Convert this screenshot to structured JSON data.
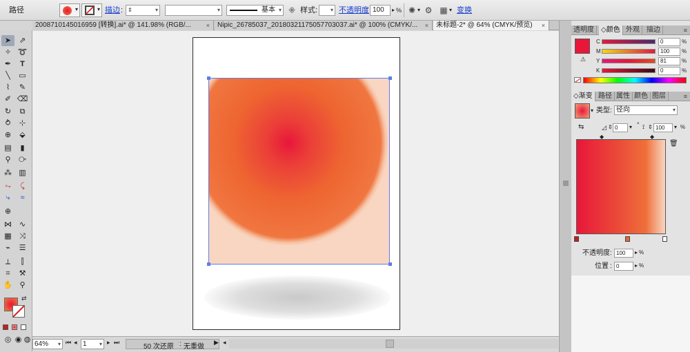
{
  "control_bar": {
    "object_type": "路径",
    "stroke_label": "描边",
    "stroke_profile_label": "基本",
    "style_label": "样式",
    "opacity_label": "不透明度",
    "opacity_value": "100",
    "opacity_unit": "%",
    "transform_label": "变换"
  },
  "tabs": [
    {
      "label": "2008710145016959 [转换].ai* @ 141.98% (RGB/...",
      "close": "×"
    },
    {
      "label": "Nipic_26785037_20180321175057703037.ai* @ 100% (CMYK/...",
      "close": "×"
    },
    {
      "label": "未标题-2* @ 64% (CMYK/预览)",
      "close": "×"
    }
  ],
  "status_bar": {
    "zoom": "64%",
    "artboard_number": "1",
    "undo_text": "50 次还原",
    "redo_text": "无重做"
  },
  "color_panel": {
    "tabs": [
      "透明度",
      "颜色",
      "外观",
      "描边"
    ],
    "active_tab": "颜色",
    "channels": [
      {
        "name": "C",
        "value": "0"
      },
      {
        "name": "M",
        "value": "100"
      },
      {
        "name": "Y",
        "value": "81"
      },
      {
        "name": "K",
        "value": "0"
      }
    ],
    "unit": "%"
  },
  "gradient_panel": {
    "tabs": [
      "渐变",
      "路径",
      "属性",
      "颜色",
      "图层"
    ],
    "active_tab": "渐变",
    "type_label": "类型",
    "type_value": "径向",
    "angle_value": "0",
    "angle_unit": "°",
    "aspect_value": "100",
    "aspect_unit": "%",
    "opacity_label": "不透明度",
    "opacity_value": "100",
    "position_label": "位置",
    "position_value": "0",
    "unit": "%"
  },
  "colors": {
    "fill": "#e8173a",
    "gradient_start": "#e8173a",
    "gradient_mid": "#ef6f3a",
    "gradient_end": "#f8d6c2",
    "selection": "#5f7de8"
  }
}
